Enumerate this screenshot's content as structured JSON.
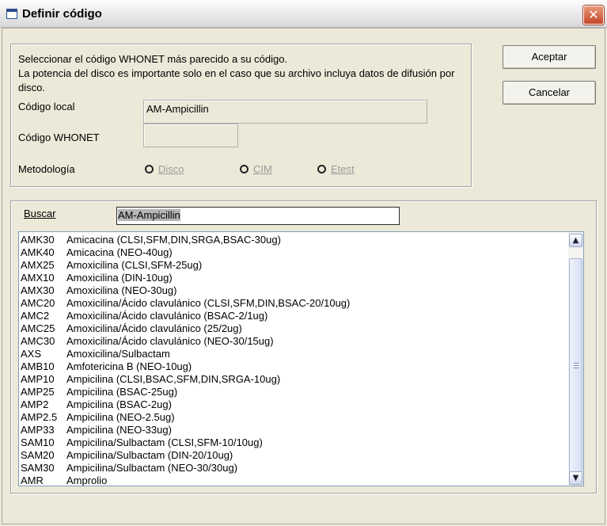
{
  "window": {
    "title": "Definir código",
    "close_glyph": "✕"
  },
  "info": {
    "line1": "Seleccionar el código WHONET más parecido a su código.",
    "line2": "La potencia del disco es importante solo en el caso que su archivo incluya datos de difusión por disco."
  },
  "form": {
    "local_code_label": "Código local",
    "local_code_value": "AM-Ampicillin",
    "whonet_code_label": "Código WHONET",
    "whonet_code_value": "",
    "method_label": "Metodología",
    "methods": [
      "Disco",
      "CIM",
      "Etest"
    ]
  },
  "buttons": {
    "accept": "Aceptar",
    "cancel": "Cancelar"
  },
  "search": {
    "label": "Buscar",
    "value": "AM-Ampicillin"
  },
  "list": {
    "items": [
      {
        "code": "AMK30",
        "desc": "Amicacina (CLSI,SFM,DIN,SRGA,BSAC-30ug)"
      },
      {
        "code": "AMK40",
        "desc": "Amicacina (NEO-40ug)"
      },
      {
        "code": "AMX25",
        "desc": "Amoxicilina (CLSI,SFM-25ug)"
      },
      {
        "code": "AMX10",
        "desc": "Amoxicilina (DIN-10ug)"
      },
      {
        "code": "AMX30",
        "desc": "Amoxicilina (NEO-30ug)"
      },
      {
        "code": "AMC20",
        "desc": "Amoxicilina/Ácido clavulánico (CLSI,SFM,DIN,BSAC-20/10ug)"
      },
      {
        "code": "AMC2",
        "desc": "Amoxicilina/Ácido clavulánico (BSAC-2/1ug)"
      },
      {
        "code": "AMC25",
        "desc": "Amoxicilina/Ácido clavulánico (25/2ug)"
      },
      {
        "code": "AMC30",
        "desc": "Amoxicilina/Ácido clavulánico (NEO-30/15ug)"
      },
      {
        "code": "AXS",
        "desc": "Amoxicilina/Sulbactam"
      },
      {
        "code": "AMB10",
        "desc": "Amfotericina B (NEO-10ug)"
      },
      {
        "code": "AMP10",
        "desc": "Ampicilina (CLSI,BSAC,SFM,DIN,SRGA-10ug)"
      },
      {
        "code": "AMP25",
        "desc": "Ampicilina (BSAC-25ug)"
      },
      {
        "code": "AMP2",
        "desc": "Ampicilina (BSAC-2ug)"
      },
      {
        "code": "AMP2.5",
        "desc": "Ampicilina (NEO-2.5ug)"
      },
      {
        "code": "AMP33",
        "desc": "Ampicilina (NEO-33ug)"
      },
      {
        "code": "SAM10",
        "desc": "Ampicilina/Sulbactam (CLSI,SFM-10/10ug)"
      },
      {
        "code": "SAM20",
        "desc": "Ampicilina/Sulbactam (DIN-20/10ug)"
      },
      {
        "code": "SAM30",
        "desc": "Ampicilina/Sulbactam (NEO-30/30ug)"
      },
      {
        "code": "AMR",
        "desc": "Amprolio"
      }
    ]
  }
}
